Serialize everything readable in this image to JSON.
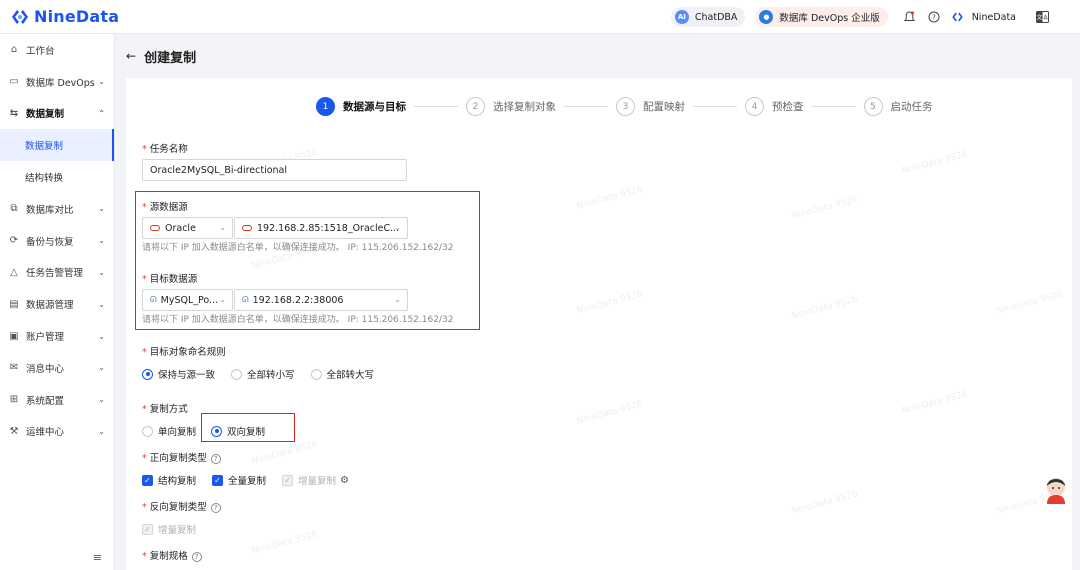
{
  "header": {
    "brand": "NineData",
    "chatdba": "ChatDBA",
    "edition": "数据库 DevOps 企业版",
    "user": "NineData",
    "colors": {
      "brand": "#1a56f0",
      "accent": "#1a56f0",
      "danger": "#d9251d"
    }
  },
  "sidebar": {
    "items": [
      {
        "label": "工作台",
        "icon": "home-icon"
      },
      {
        "label": "数据库 DevOps",
        "icon": "monitor-icon"
      },
      {
        "label": "数据复制",
        "icon": "replicate-icon"
      },
      {
        "label": "数据复制"
      },
      {
        "label": "结构转换"
      },
      {
        "label": "数据库对比",
        "icon": "compare-icon"
      },
      {
        "label": "备份与恢复",
        "icon": "backup-icon"
      },
      {
        "label": "任务告警管理",
        "icon": "alert-icon"
      },
      {
        "label": "数据源管理",
        "icon": "datasource-icon"
      },
      {
        "label": "账户管理",
        "icon": "account-icon"
      },
      {
        "label": "消息中心",
        "icon": "mail-icon"
      },
      {
        "label": "系统配置",
        "icon": "grid-icon"
      },
      {
        "label": "运维中心",
        "icon": "wrench-icon"
      }
    ]
  },
  "page": {
    "title": "创建复制"
  },
  "steps": [
    {
      "num": "1",
      "label": "数据源与目标"
    },
    {
      "num": "2",
      "label": "选择复制对象"
    },
    {
      "num": "3",
      "label": "配置映射"
    },
    {
      "num": "4",
      "label": "预检查"
    },
    {
      "num": "5",
      "label": "启动任务"
    }
  ],
  "form": {
    "task_name_label": "任务名称",
    "task_name_value": "Oracle2MySQL_Bi-directional",
    "source_label": "源数据源",
    "source_type": "Oracle",
    "source_instance": "192.168.2.85:1518_OracleC...",
    "whitelist_hint": "请将以下 IP 加入数据源白名单，以确保连接成功。 IP: 115.206.152.162/32",
    "target_label": "目标数据源",
    "target_type": "MySQL_Po...",
    "target_instance": "192.168.2.2:38006",
    "naming_label": "目标对象命名规则",
    "naming_options": [
      "保持与源一致",
      "全部转小写",
      "全部转大写"
    ],
    "mode_label": "复制方式",
    "mode_options": [
      "单向复制",
      "双向复制"
    ],
    "forward_label": "正向复制类型",
    "forward_options": [
      "结构复制",
      "全量复制",
      "增量复制"
    ],
    "reverse_label": "反向复制类型",
    "reverse_options": [
      "增量复制"
    ],
    "spec_label": "复制规格"
  },
  "watermark": "NineData 9526"
}
